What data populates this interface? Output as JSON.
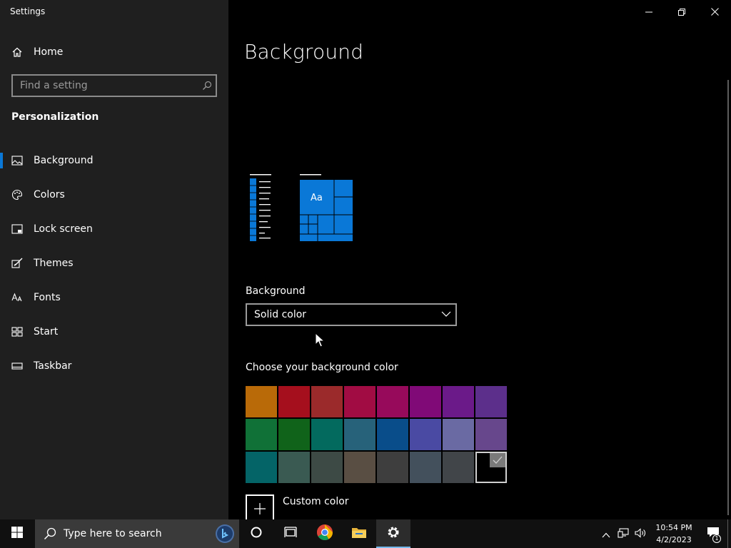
{
  "window": {
    "title": "Settings"
  },
  "sidebar": {
    "home_label": "Home",
    "search_placeholder": "Find a setting",
    "section_title": "Personalization",
    "items": [
      {
        "label": "Background",
        "icon": "image-icon",
        "active": true
      },
      {
        "label": "Colors",
        "icon": "palette-icon",
        "active": false
      },
      {
        "label": "Lock screen",
        "icon": "lock-screen-icon",
        "active": false
      },
      {
        "label": "Themes",
        "icon": "brush-icon",
        "active": false
      },
      {
        "label": "Fonts",
        "icon": "font-icon",
        "active": false
      },
      {
        "label": "Start",
        "icon": "start-layout-icon",
        "active": false
      },
      {
        "label": "Taskbar",
        "icon": "taskbar-icon",
        "active": false
      }
    ]
  },
  "main": {
    "title": "Background",
    "preview": {
      "tile_text": "Aa",
      "accent": "#0a78d7"
    },
    "background_label": "Background",
    "background_value": "Solid color",
    "color_label": "Choose your background color",
    "colors": [
      "#b96a08",
      "#a50f1d",
      "#9b2a2b",
      "#a10c43",
      "#970a5b",
      "#800a77",
      "#6b1a89",
      "#5c2f8b",
      "#107137",
      "#10631a",
      "#036a5e",
      "#27627a",
      "#094d8a",
      "#4a4aa3",
      "#6a6aa3",
      "#67478c",
      "#046467",
      "#3a5a52",
      "#3d4a45",
      "#594e43",
      "#3e3e3e",
      "#43505c",
      "#414549",
      "#000000"
    ],
    "selected_color_index": 23,
    "custom_color_label": "Custom color"
  },
  "taskbar": {
    "search_placeholder": "Type here to search",
    "time": "10:54 PM",
    "date": "4/2/2023",
    "notification_count": "1"
  }
}
